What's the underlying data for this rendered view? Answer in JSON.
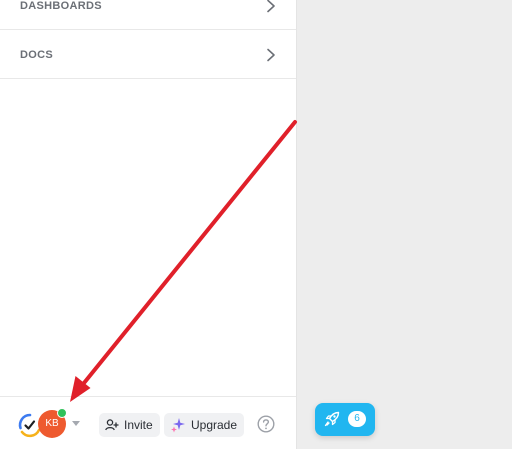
{
  "sidebar": {
    "nav_items": [
      {
        "label": "DASHBOARDS",
        "icon": "chevron-right-icon"
      },
      {
        "label": "DOCS",
        "icon": "chevron-right-icon"
      }
    ]
  },
  "footer": {
    "avatar_initials": "KB",
    "avatar_color": "#ee5a2f",
    "online_status_color": "#2fc15a",
    "invite_label": "Invite",
    "upgrade_label": "Upgrade"
  },
  "rocket_widget": {
    "count": "6",
    "accent": "#21b6f0"
  },
  "annotation": {
    "arrow_color": "#e0202a"
  }
}
